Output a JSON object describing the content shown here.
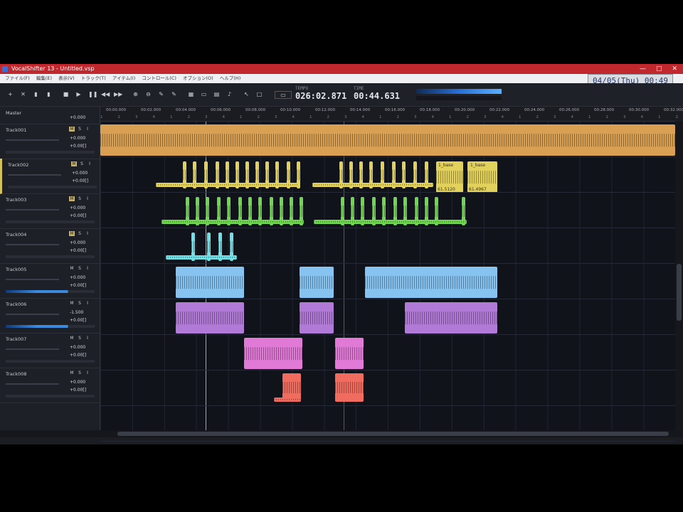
{
  "window": {
    "title": "VocalShifter 13 - Untitled.vsp",
    "minimize": "—",
    "maximize": "□",
    "close": "✕"
  },
  "menu": [
    "ファイル(F)",
    "編集(E)",
    "表示(V)",
    "トラック(T)",
    "アイテム(I)",
    "コントロール(C)",
    "オプション(O)",
    "ヘルプ(H)"
  ],
  "clock": "04/05(Thu) 00:49",
  "transport": {
    "label_a": "TEMPO",
    "value_a": "026:02.871",
    "label_b": "TIME",
    "value_b": "00:44.631"
  },
  "master": {
    "name": "Master",
    "value": "+0.000"
  },
  "tracks": [
    {
      "name": "Track001",
      "btn1": "M",
      "btn2": "S",
      "btn3": "I",
      "v1": "+0.000",
      "v2": "+0.00[]"
    },
    {
      "name": "Track002",
      "btn1": "M",
      "btn2": "S",
      "btn3": "I",
      "v1": "+0.000",
      "v2": "+0.00[]"
    },
    {
      "name": "Track003",
      "btn1": "M",
      "btn2": "S",
      "btn3": "I",
      "v1": "+0.000",
      "v2": "+0.00[]"
    },
    {
      "name": "Track004",
      "btn1": "M",
      "btn2": "S",
      "btn3": "I",
      "v1": "+0.000",
      "v2": "+0.00[]"
    },
    {
      "name": "Track005",
      "btn1": "M",
      "btn2": "S",
      "btn3": "I",
      "v1": "+0.000",
      "v2": "+0.00[]"
    },
    {
      "name": "Track006",
      "btn1": "M",
      "btn2": "S",
      "btn3": "I",
      "v1": "-1.500",
      "v2": "+0.00[]"
    },
    {
      "name": "Track007",
      "btn1": "M",
      "btn2": "S",
      "btn3": "I",
      "v1": "+0.000",
      "v2": "+0.00[]"
    },
    {
      "name": "Track008",
      "btn1": "M",
      "btn2": "S",
      "btn3": "I",
      "v1": "+0.000",
      "v2": "+0.00[]"
    }
  ],
  "timeline_ticks": [
    "00:00.000",
    "00:02.000",
    "00:04.000",
    "00:06.000",
    "00:08.000",
    "00:10.000",
    "00:12.000",
    "00:14.000",
    "00:16.000",
    "00:18.000",
    "00:20.000",
    "00:22.000",
    "00:24.000",
    "00:26.000",
    "00:28.000",
    "00:30.000",
    "00:32.000"
  ],
  "clip_labels": {
    "y1": "1_base",
    "y2": "1_base",
    "y3": "61.5120",
    "y4": "61.4967"
  },
  "colors": {
    "titlebar": "#c0282d",
    "orange": "#d9a054",
    "yellow": "#e2d15a",
    "green": "#6fd64f",
    "cyan": "#6fe0e6",
    "blue": "#86c3f0",
    "purple": "#b07ad6",
    "magenta": "#e07ad6",
    "red": "#ef6c5e"
  }
}
